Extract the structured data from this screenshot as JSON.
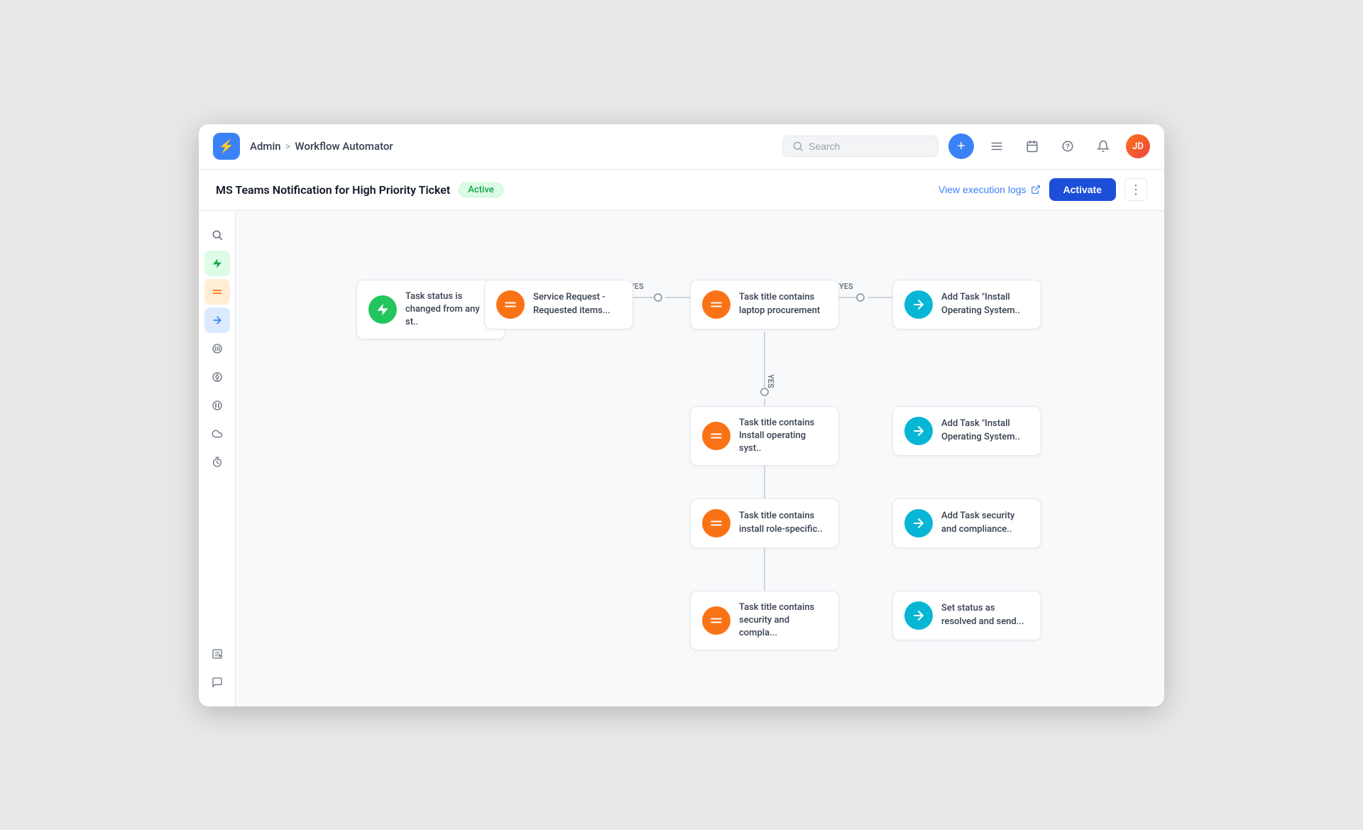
{
  "nav": {
    "logo_icon": "⚡",
    "breadcrumb_root": "Admin",
    "breadcrumb_sep": ">",
    "breadcrumb_page": "Workflow Automator",
    "search_placeholder": "Search",
    "add_icon": "+",
    "avatar_initials": "JD"
  },
  "subheader": {
    "title": "MS Teams Notification for High Priority Ticket",
    "status": "Active",
    "view_logs_label": "View execution logs",
    "activate_label": "Activate",
    "more_icon": "⋮"
  },
  "sidebar": {
    "icons": [
      {
        "name": "search",
        "glyph": "🔍",
        "class": ""
      },
      {
        "name": "trigger",
        "glyph": "⚡",
        "class": "green"
      },
      {
        "name": "condition",
        "glyph": "=",
        "class": "orange"
      },
      {
        "name": "action",
        "glyph": "→",
        "class": "blue"
      },
      {
        "name": "parallel",
        "glyph": "⚙",
        "class": ""
      },
      {
        "name": "integration",
        "glyph": "🔗",
        "class": ""
      },
      {
        "name": "pause",
        "glyph": "⏸",
        "class": ""
      },
      {
        "name": "cloud",
        "glyph": "☁",
        "class": ""
      },
      {
        "name": "time",
        "glyph": "⏱",
        "class": ""
      },
      {
        "name": "log",
        "glyph": "📋",
        "class": ""
      },
      {
        "name": "chat",
        "glyph": "💬",
        "class": ""
      }
    ]
  },
  "workflow": {
    "nodes": {
      "trigger": {
        "label": "Task status is changed from any st.."
      },
      "condition1": {
        "label": "Service Request - Requested items..."
      },
      "condition2": {
        "label": "Task title contains laptop procurement"
      },
      "action1": {
        "label": "Add Task \"Install Operating System.."
      },
      "condition3": {
        "label": "Task title contains Install operating syst.."
      },
      "action2": {
        "label": "Add Task \"Install Operating System.."
      },
      "condition4": {
        "label": "Task title contains install role-specific.."
      },
      "action3": {
        "label": "Add Task security and compliance.."
      },
      "condition5": {
        "label": "Task title contains security and compla..."
      },
      "action4": {
        "label": "Set status as resolved and send..."
      }
    },
    "yes_label": "YES"
  }
}
